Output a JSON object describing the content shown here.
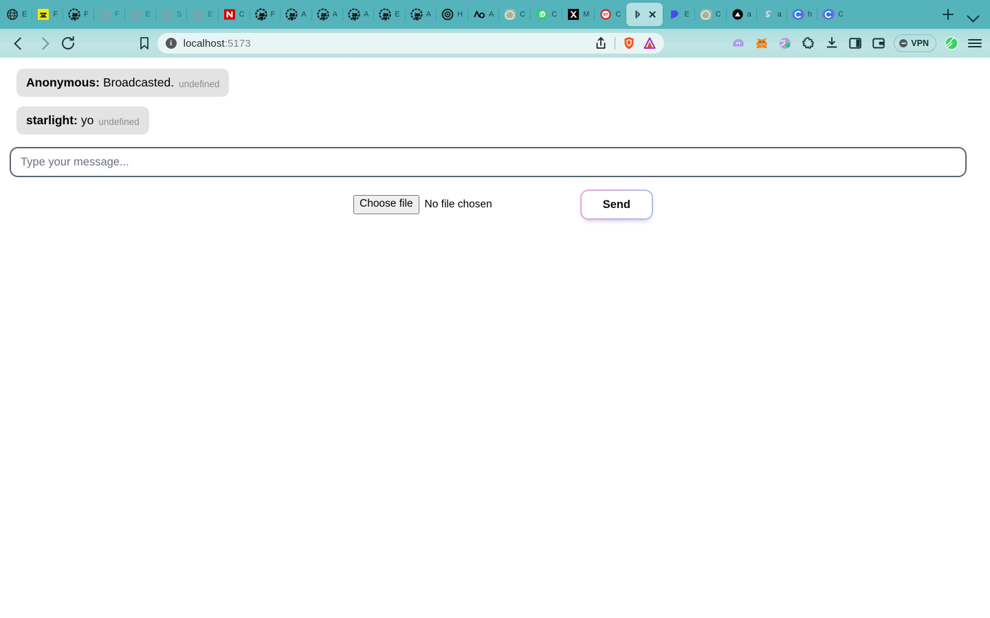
{
  "browser": {
    "tabs": [
      {
        "title": "E",
        "icon": "globe-grid-icon",
        "color": "#2b2b2b",
        "active": false,
        "muted": false
      },
      {
        "title": "F",
        "icon": "yellow-note-icon",
        "color": "#f5e600",
        "active": false,
        "muted": false
      },
      {
        "title": "F",
        "icon": "github-icon",
        "color": "#1b1f23",
        "active": false,
        "muted": false
      },
      {
        "title": "F",
        "icon": "github-icon",
        "color": "#c98b95",
        "active": false,
        "muted": true
      },
      {
        "title": "E",
        "icon": "github-icon",
        "color": "#c98b95",
        "active": false,
        "muted": true
      },
      {
        "title": "S",
        "icon": "github-icon",
        "color": "#c98b95",
        "active": false,
        "muted": true
      },
      {
        "title": "E",
        "icon": "github-icon",
        "color": "#c98b95",
        "active": false,
        "muted": true
      },
      {
        "title": "C",
        "icon": "nvidia-icon",
        "color": "#d10000",
        "active": false,
        "muted": false
      },
      {
        "title": "F",
        "icon": "github-dark-icon",
        "color": "#111111",
        "active": false,
        "muted": false
      },
      {
        "title": "A",
        "icon": "github-icon",
        "color": "#1b1f23",
        "active": false,
        "muted": false
      },
      {
        "title": "A",
        "icon": "github-icon",
        "color": "#1b1f23",
        "active": false,
        "muted": false
      },
      {
        "title": "A",
        "icon": "github-icon",
        "color": "#1b1f23",
        "active": false,
        "muted": false
      },
      {
        "title": "E",
        "icon": "github-icon",
        "color": "#1b1f23",
        "active": false,
        "muted": false
      },
      {
        "title": "A",
        "icon": "github-icon",
        "color": "#1b1f23",
        "active": false,
        "muted": false
      },
      {
        "title": "H",
        "icon": "target-icon",
        "color": "#111111",
        "active": false,
        "muted": false
      },
      {
        "title": "A",
        "icon": "ao-logo-icon",
        "color": "#111111",
        "active": false,
        "muted": false
      },
      {
        "title": "C",
        "icon": "openai-icon",
        "color": "#8f9d8a",
        "active": false,
        "muted": false
      },
      {
        "title": "C",
        "icon": "whatsapp-icon",
        "color": "#25d366",
        "active": false,
        "muted": false
      },
      {
        "title": "M",
        "icon": "x-twitter-icon",
        "color": "#000000",
        "active": false,
        "muted": false
      },
      {
        "title": "C",
        "icon": "reddit-badge-icon",
        "color": "#e01b24",
        "active": false,
        "muted": false
      },
      {
        "title": "",
        "icon": "localhost-icon",
        "color": "#14343a",
        "active": true,
        "muted": false
      },
      {
        "title": "E",
        "icon": "blue-shape-icon",
        "color": "#4a4ae8",
        "active": false,
        "muted": false
      },
      {
        "title": "C",
        "icon": "openai-icon",
        "color": "#8f9d8a",
        "active": false,
        "muted": false
      },
      {
        "title": "a",
        "icon": "vercel-icon",
        "color": "#000000",
        "active": false,
        "muted": false
      },
      {
        "title": "a",
        "icon": "ghost-s-icon",
        "color": "#dcdcdc",
        "active": false,
        "muted": false
      },
      {
        "title": "h",
        "icon": "copilot-icon",
        "color": "#2f7ce0",
        "active": false,
        "muted": false
      },
      {
        "title": "C",
        "icon": "copilot-icon",
        "color": "#2f7ce0",
        "active": false,
        "muted": false
      }
    ],
    "new_tab_label": "+",
    "tab_list_label": "Show all tabs",
    "nav": {
      "back_label": "Back",
      "forward_label": "Forward",
      "reload_label": "Reload"
    },
    "url": {
      "host": "localhost",
      "port": ":5173",
      "security_label": "Site information",
      "bookmark_label": "Bookmark this page",
      "share_label": "Share this page",
      "shields_label": "Brave Shields",
      "rewards_label": "Brave Rewards"
    },
    "extensions": [
      {
        "name": "phantom-wallet-icon",
        "label": "Phantom"
      },
      {
        "name": "metamask-icon",
        "label": "MetaMask"
      },
      {
        "name": "wallet-extension-icon",
        "label": "Wallet"
      },
      {
        "name": "extensions-puzzle-icon",
        "label": "Extensions"
      },
      {
        "name": "downloads-icon",
        "label": "Downloads"
      },
      {
        "name": "sidebar-toggle-icon",
        "label": "Toggle sidebar"
      },
      {
        "name": "brave-wallet-icon",
        "label": "Brave Wallet"
      }
    ],
    "vpn": {
      "label": "VPN"
    },
    "profile_label": "Profile",
    "menu_label": "Customize and control Brave"
  },
  "chat": {
    "messages": [
      {
        "sender": "Anonymous:",
        "text": "Broadcasted.",
        "timestamp": "undefined"
      },
      {
        "sender": "starlight:",
        "text": "yo",
        "timestamp": "undefined"
      }
    ],
    "input": {
      "value": "",
      "placeholder": "Type your message..."
    },
    "file": {
      "button_label": "Choose file",
      "status": "No file chosen"
    },
    "send_label": "Send"
  },
  "colors": {
    "tabstrip": "#55b3bb",
    "toolbar": "#bfe4e3",
    "url_pill": "#e9f5f4",
    "bubble": "#e3e3e3",
    "input_border": "#5a6472",
    "send_gradient_start": "#e8a8d8",
    "send_gradient_end": "#a8c4ef"
  }
}
